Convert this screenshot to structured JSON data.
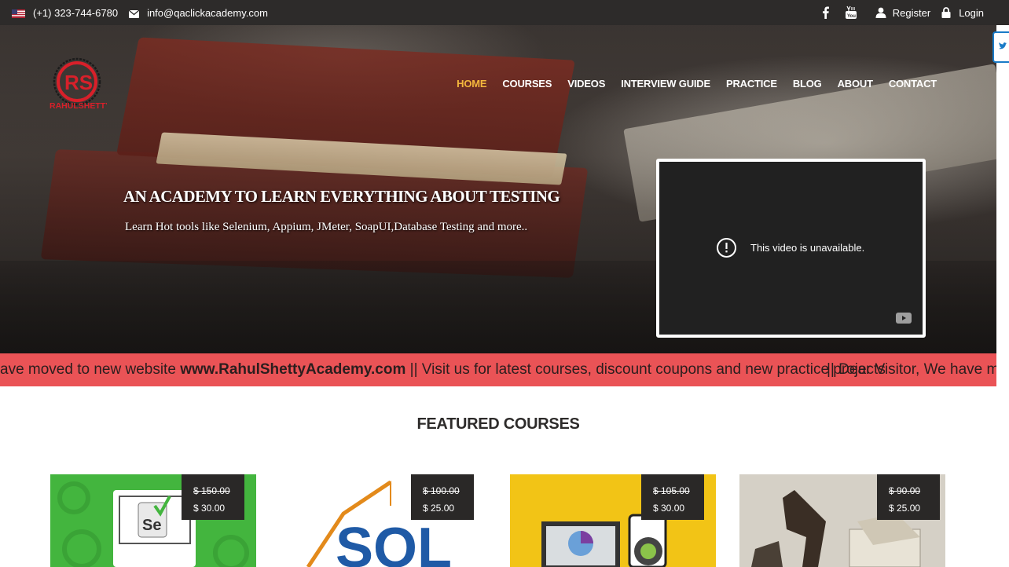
{
  "topbar": {
    "phone": "(+1) 323-744-6780",
    "email": "info@qaclickacademy.com",
    "register": "Register",
    "login": "Login",
    "icons": [
      "us-flag-icon",
      "envelope-icon",
      "facebook-icon",
      "youtube-icon",
      "user-icon",
      "lock-icon"
    ]
  },
  "brand": {
    "logo_initials": "RS",
    "logo_text": "RAHULSHETTY"
  },
  "nav": {
    "items": [
      "HOME",
      "COURSES",
      "VIDEOS",
      "INTERVIEW GUIDE",
      "PRACTICE",
      "BLOG",
      "ABOUT",
      "CONTACT"
    ],
    "active": "HOME",
    "active_color": "#f3b73d"
  },
  "hero": {
    "title": "AN ACADEMY TO LEARN EVERYTHING ABOUT TESTING",
    "subtitle": "Learn Hot tools like Selenium, Appium, JMeter, SoapUI,Database Testing and more.."
  },
  "video": {
    "message": "This video is unavailable."
  },
  "marquee": {
    "lead": "ave moved to new website ",
    "link": "www.RahulShettyAcademy.com",
    "tail": " || Visit us for latest courses, discount coupons and new practice projects",
    "repeat": "|| Dear Visitor, We have m",
    "bg_color": "#ea5356"
  },
  "featured": {
    "heading": "FEATURED COURSES"
  },
  "courses": [
    {
      "old_price": "$ 150.00",
      "new_price": "$ 30.00"
    },
    {
      "old_price": "$ 100.00",
      "new_price": "$ 25.00"
    },
    {
      "old_price": "$ 105.00",
      "new_price": "$ 30.00"
    },
    {
      "old_price": "$ 90.00",
      "new_price": "$ 25.00"
    }
  ]
}
